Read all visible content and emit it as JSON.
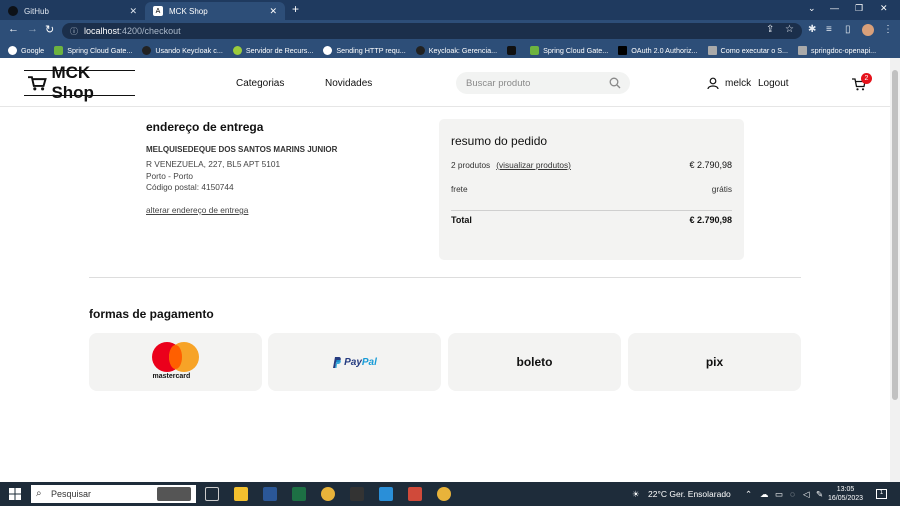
{
  "browser": {
    "tabs": [
      {
        "label": "GitHub",
        "active": false
      },
      {
        "label": "MCK Shop",
        "active": true
      }
    ],
    "url_host": "localhost",
    "url_path": ":4200/checkout",
    "bookmarks": [
      "Google",
      "Spring Cloud Gate...",
      "Usando Keycloak c...",
      "Servidor de Recurs...",
      "Sending HTTP requ...",
      "Keycloak: Gerencia...",
      "",
      "Spring Cloud Gate...",
      "OAuth 2.0 Authoriz...",
      "Como executar o S...",
      "springdoc-openapi..."
    ]
  },
  "header": {
    "logo": "MCK Shop",
    "nav": [
      "Categorias",
      "Novidades"
    ],
    "search_placeholder": "Buscar produto",
    "username": "melck",
    "logout": "Logout",
    "cart_count": "2"
  },
  "address": {
    "title": "endereço de entrega",
    "name": "MELQUISEDEQUE DOS SANTOS MARINS JUNIOR",
    "line1": "R VENEZUELA, 227, BL5 APT 5101",
    "line2": "Porto - Porto",
    "line3": "Código postal: 4150744",
    "change_link": "alterar endereço de entrega"
  },
  "summary": {
    "title": "resumo do pedido",
    "products_label": "2 produtos",
    "view_link": "(visualizar produtos)",
    "products_value": "€ 2.790,98",
    "shipping_label": "frete",
    "shipping_value": "grátis",
    "total_label": "Total",
    "total_value": "€ 2.790,98"
  },
  "payment": {
    "title": "formas de pagamento",
    "mastercard_label": "mastercard",
    "paypal_label_1": "Pay",
    "paypal_label_2": "Pal",
    "boleto": "boleto",
    "pix": "pix"
  },
  "taskbar": {
    "search": "Pesquisar",
    "weather": "22°C  Ger. Ensolarado",
    "time": "13:05",
    "date": "16/05/2023"
  },
  "colors": {
    "accent_badge": "#e5121b",
    "card_bg": "#f3f3f2",
    "browser_frame": "#2d4e78"
  }
}
